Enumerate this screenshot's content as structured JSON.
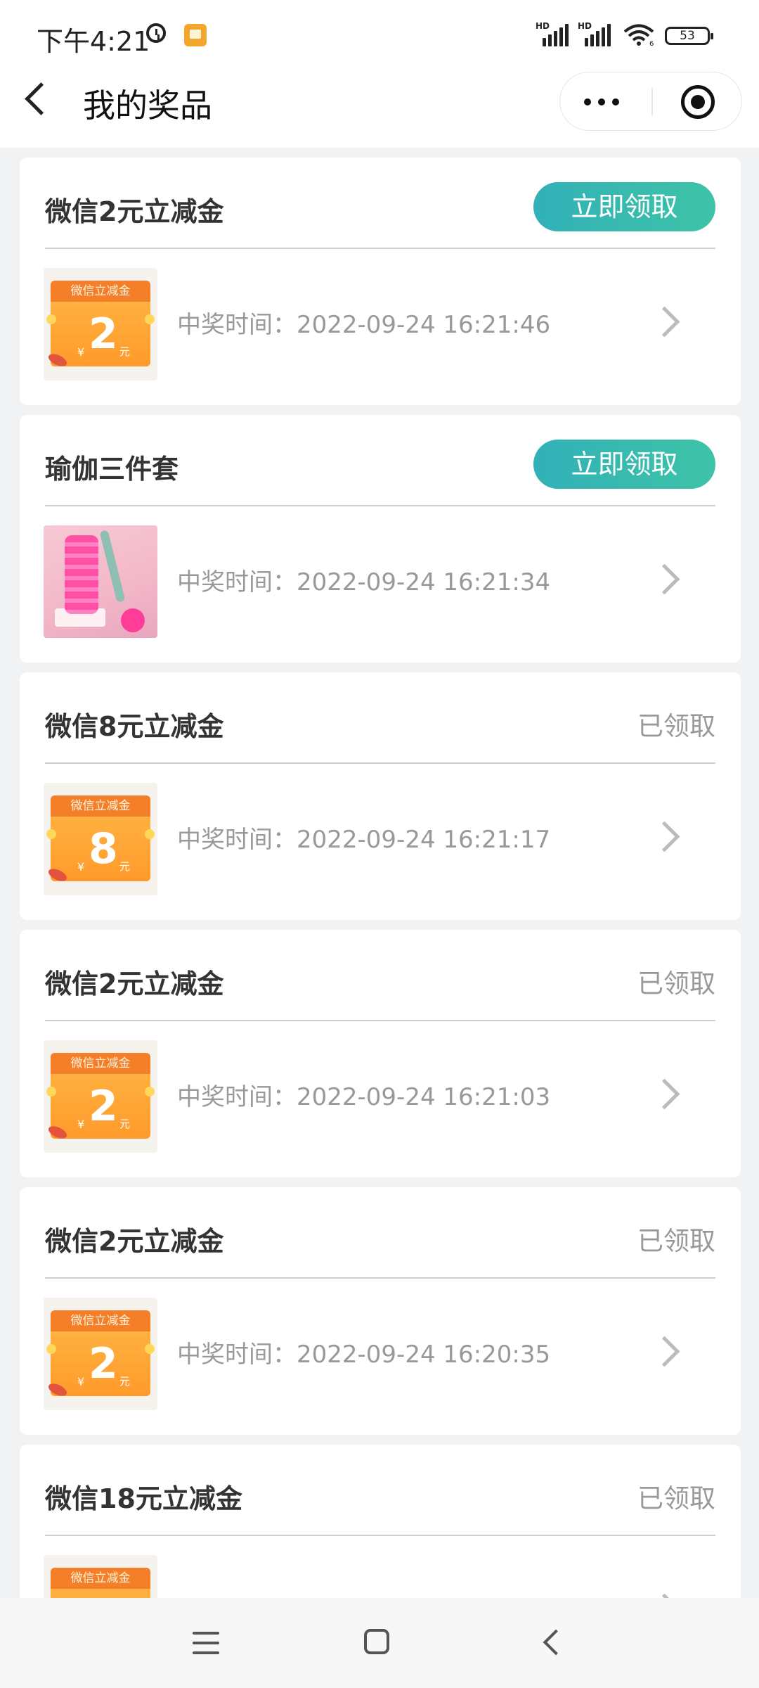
{
  "status_bar": {
    "time": "下午4:21",
    "battery": "53",
    "signal1_label": "HD",
    "signal2_label": "HD",
    "wifi_sub": "6"
  },
  "nav": {
    "title": "我的奖品"
  },
  "prizes": [
    {
      "name": "微信2元立减金",
      "claim_label": "立即领取",
      "status": "",
      "time_label": "中奖时间：2022-09-24 16:21:46",
      "thumb": "coupon",
      "coupon_title": "微信立减金",
      "coupon_symbol": "¥",
      "coupon_value": "2",
      "coupon_unit": "元"
    },
    {
      "name": "瑜伽三件套",
      "claim_label": "立即领取",
      "status": "",
      "time_label": "中奖时间：2022-09-24 16:21:34",
      "thumb": "yoga"
    },
    {
      "name": "微信8元立减金",
      "claim_label": "",
      "status": "已领取",
      "time_label": "中奖时间：2022-09-24 16:21:17",
      "thumb": "coupon",
      "coupon_title": "微信立减金",
      "coupon_symbol": "¥",
      "coupon_value": "8",
      "coupon_unit": "元"
    },
    {
      "name": "微信2元立减金",
      "claim_label": "",
      "status": "已领取",
      "time_label": "中奖时间：2022-09-24 16:21:03",
      "thumb": "coupon",
      "coupon_title": "微信立减金",
      "coupon_symbol": "¥",
      "coupon_value": "2",
      "coupon_unit": "元"
    },
    {
      "name": "微信2元立减金",
      "claim_label": "",
      "status": "已领取",
      "time_label": "中奖时间：2022-09-24 16:20:35",
      "thumb": "coupon",
      "coupon_title": "微信立减金",
      "coupon_symbol": "¥",
      "coupon_value": "2",
      "coupon_unit": "元"
    },
    {
      "name": "微信18元立减金",
      "claim_label": "",
      "status": "已领取",
      "time_label": "",
      "thumb": "coupon",
      "coupon_title": "微信立减金",
      "coupon_symbol": "",
      "coupon_value": "",
      "coupon_unit": ""
    }
  ],
  "colors": {
    "claim_button": "#3ab8b0",
    "claimed_text": "#999999",
    "coupon_orange": "#ff9a2a"
  },
  "icons": {
    "status": [
      "alarm-icon",
      "app-badge-icon",
      "signal-icon",
      "wifi-icon",
      "battery-icon"
    ],
    "nav": [
      "back-icon",
      "more-icon",
      "target-icon"
    ],
    "system": [
      "menu-icon",
      "home-icon",
      "nav-back-icon"
    ]
  }
}
